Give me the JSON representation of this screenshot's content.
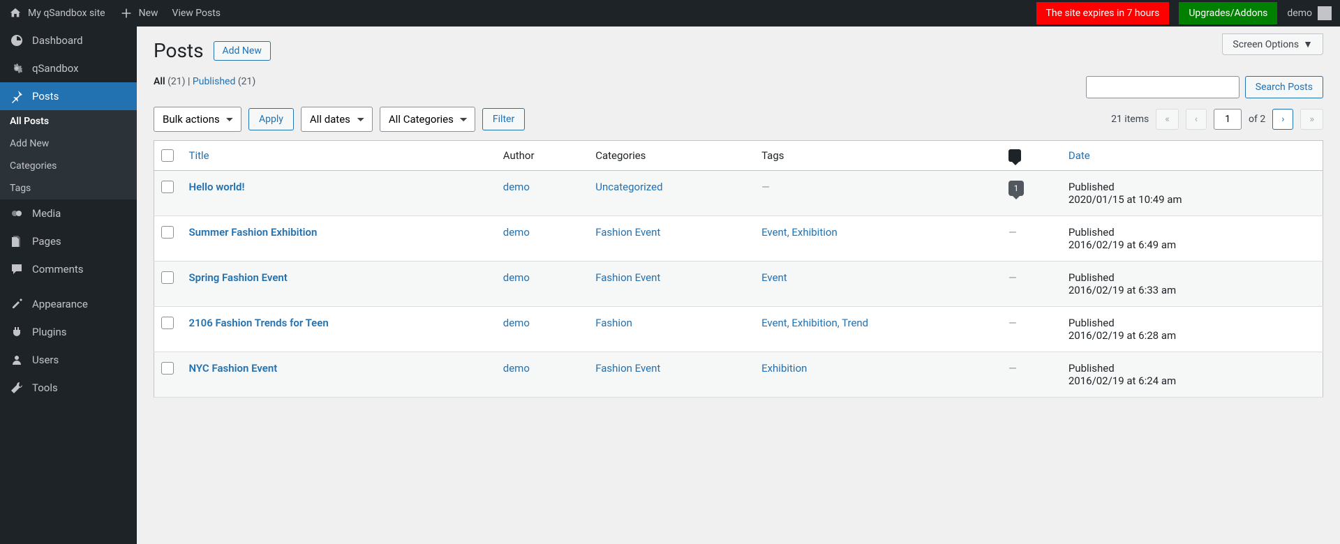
{
  "adminbar": {
    "site_name": "My qSandbox site",
    "new_label": "New",
    "view_posts": "View Posts",
    "expire_text": "The site expires in  7 hours",
    "upgrades": "Upgrades/Addons",
    "user": "demo"
  },
  "sidebar": {
    "dashboard": "Dashboard",
    "qsandbox": "qSandbox",
    "posts": "Posts",
    "submenu": {
      "all_posts": "All Posts",
      "add_new": "Add New",
      "categories": "Categories",
      "tags": "Tags"
    },
    "media": "Media",
    "pages": "Pages",
    "comments": "Comments",
    "appearance": "Appearance",
    "plugins": "Plugins",
    "users": "Users",
    "tools": "Tools"
  },
  "screen_options": "Screen Options",
  "page": {
    "title": "Posts",
    "add_new": "Add New"
  },
  "filters": {
    "all_label": "All",
    "all_count": "(21)",
    "published_label": "Published",
    "published_count": "(21)",
    "bulk_actions": "Bulk actions",
    "apply": "Apply",
    "all_dates": "All dates",
    "all_categories": "All Categories",
    "filter": "Filter",
    "search_btn": "Search Posts"
  },
  "pagination": {
    "items_label": "21 items",
    "current_page": "1",
    "total_label": "of 2",
    "first": "«",
    "prev": "‹",
    "next": "›",
    "last": "»"
  },
  "columns": {
    "title": "Title",
    "author": "Author",
    "categories": "Categories",
    "tags": "Tags",
    "date": "Date"
  },
  "rows": [
    {
      "title": "Hello world!",
      "author": "demo",
      "categories": "Uncategorized",
      "tags": "—",
      "comments": "1",
      "status": "Published",
      "datetime": "2020/01/15 at 10:49 am"
    },
    {
      "title": "Summer Fashion Exhibition",
      "author": "demo",
      "categories": "Fashion Event",
      "tags": "Event, Exhibition",
      "comments": "—",
      "status": "Published",
      "datetime": "2016/02/19 at 6:49 am"
    },
    {
      "title": "Spring Fashion Event",
      "author": "demo",
      "categories": "Fashion Event",
      "tags": "Event",
      "comments": "—",
      "status": "Published",
      "datetime": "2016/02/19 at 6:33 am"
    },
    {
      "title": "2106 Fashion Trends for Teen",
      "author": "demo",
      "categories": "Fashion",
      "tags": "Event, Exhibition, Trend",
      "comments": "—",
      "status": "Published",
      "datetime": "2016/02/19 at 6:28 am"
    },
    {
      "title": "NYC Fashion Event",
      "author": "demo",
      "categories": "Fashion Event",
      "tags": "Exhibition",
      "comments": "—",
      "status": "Published",
      "datetime": "2016/02/19 at 6:24 am"
    }
  ]
}
